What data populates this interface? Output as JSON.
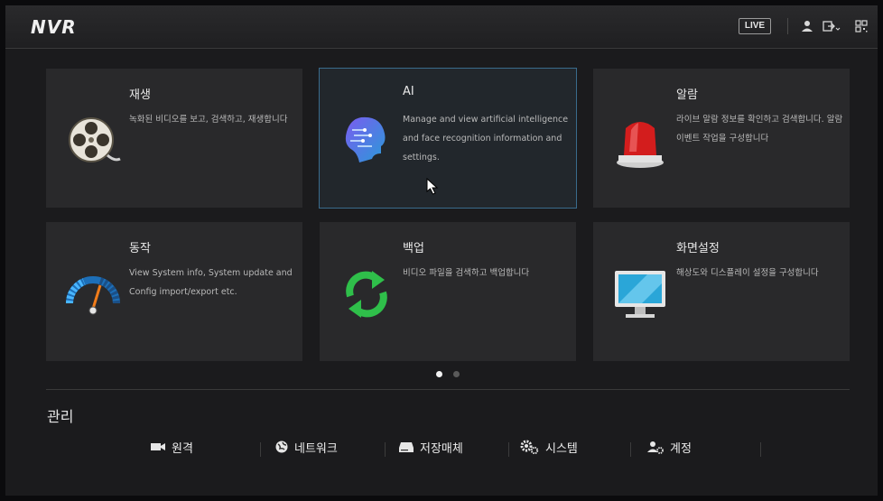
{
  "header": {
    "logo": "NVR",
    "live_label": "LIVE",
    "icons": [
      "user-icon",
      "logout-icon",
      "qr-code-icon"
    ]
  },
  "cards": [
    {
      "title": "재생",
      "desc": "녹화된 비디오를 보고, 검색하고, 재생합니다",
      "icon": "film-reel-icon"
    },
    {
      "title": "AI",
      "desc": "Manage and view artificial intelligence and face recognition information and settings.",
      "icon": "ai-head-icon"
    },
    {
      "title": "알람",
      "desc": "라이브 알람 정보를 확인하고 검색합니다. 알람 이벤트 작업을 구성합니다",
      "icon": "alarm-light-icon"
    },
    {
      "title": "동작",
      "desc": "View System info, System update and Config import/export etc.",
      "icon": "speedometer-icon"
    },
    {
      "title": "백업",
      "desc": "비디오 파일을 검색하고 백업합니다",
      "icon": "refresh-arrows-icon"
    },
    {
      "title": "화면설정",
      "desc": "해상도와 디스플레이 설정을 구성합니다",
      "icon": "monitor-icon"
    }
  ],
  "pager": {
    "current_page": 1,
    "total_pages": 2
  },
  "management": {
    "title": "관리",
    "items": [
      {
        "label": "원격",
        "icon": "camera-icon"
      },
      {
        "label": "네트워크",
        "icon": "globe-network-icon"
      },
      {
        "label": "저장매체",
        "icon": "hard-drive-icon"
      },
      {
        "label": "시스템",
        "icon": "gears-icon"
      },
      {
        "label": "계정",
        "icon": "user-gear-icon"
      }
    ]
  },
  "colors": {
    "accent": "#3a6b8c",
    "background": "#1b1b1d",
    "card": "#29292b"
  }
}
